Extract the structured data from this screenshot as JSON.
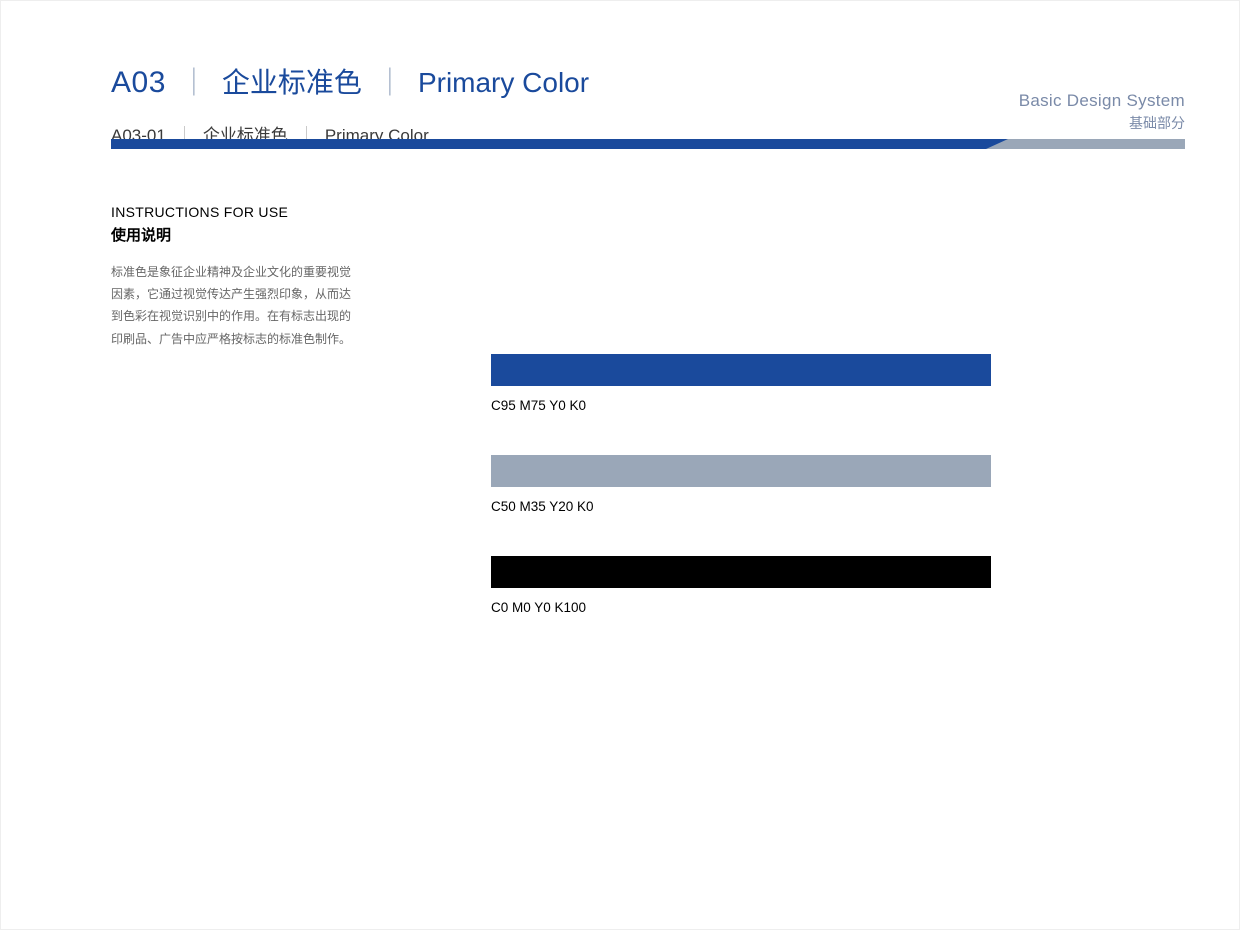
{
  "header": {
    "code": "A03",
    "title_cn": "企业标准色",
    "title_en": "Primary Color",
    "sub_code": "A03-01",
    "sub_cn": "企业标准色",
    "sub_en": "Primary Color"
  },
  "right_label": {
    "en": "Basic Design System",
    "cn": "基础部分"
  },
  "instructions": {
    "heading_en": "INSTRUCTIONS FOR USE",
    "heading_cn": "使用说明",
    "body": "标准色是象征企业精神及企业文化的重要视觉因素，它通过视觉传达产生强烈印象，从而达到色彩在视觉识别中的作用。在有标志出现的印刷品、广告中应严格按标志的标准色制作。"
  },
  "swatches": [
    {
      "cmyk": "C95 M75 Y0 K0",
      "hex": "#1a4a9c"
    },
    {
      "cmyk": "C50 M35 Y20 K0",
      "hex": "#9aa7b8"
    },
    {
      "cmyk": "C0 M0 Y0 K100",
      "hex": "#000000"
    }
  ]
}
